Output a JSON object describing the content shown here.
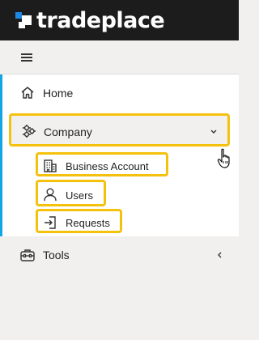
{
  "brand": {
    "name": "tradeplace"
  },
  "colors": {
    "accent_bar": "#12a7e2",
    "highlight": "#f4c20d",
    "topbar": "#1c1c1c",
    "logo_blue": "#1e88e5"
  },
  "toolbar": {
    "menu_icon": "hamburger-icon"
  },
  "nav": {
    "home": {
      "label": "Home",
      "icon": "home-icon"
    },
    "company": {
      "label": "Company",
      "icon": "company-icon",
      "expanded": true,
      "chevron": "chevron-down-icon",
      "children": [
        {
          "label": "Business Account",
          "icon": "building-icon"
        },
        {
          "label": "Users",
          "icon": "user-icon"
        },
        {
          "label": "Requests",
          "icon": "sign-in-icon"
        }
      ]
    },
    "tools": {
      "label": "Tools",
      "icon": "toolbox-icon",
      "chevron": "chevron-left-icon"
    }
  },
  "pointer": {
    "icon": "hand-cursor-icon"
  }
}
